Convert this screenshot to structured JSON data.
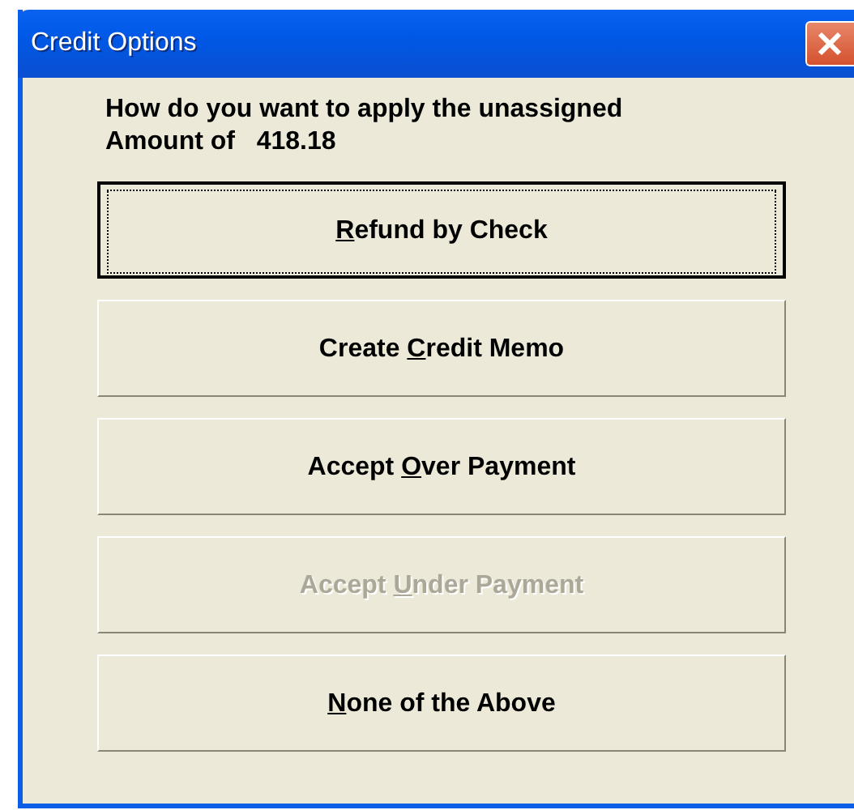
{
  "window": {
    "title": "Credit Options"
  },
  "message": [
    "How do you want to apply the unassigned",
    "Amount of   418.18"
  ],
  "buttons": [
    {
      "parts": [
        {
          "text": "R",
          "underlined": true
        },
        {
          "text": "efund by Check",
          "underlined": false
        }
      ],
      "focused": true,
      "disabled": false
    },
    {
      "parts": [
        {
          "text": "Create ",
          "underlined": false
        },
        {
          "text": "C",
          "underlined": true
        },
        {
          "text": "redit Memo",
          "underlined": false
        }
      ],
      "focused": false,
      "disabled": false
    },
    {
      "parts": [
        {
          "text": "Accept ",
          "underlined": false
        },
        {
          "text": "O",
          "underlined": true
        },
        {
          "text": "ver Payment",
          "underlined": false
        }
      ],
      "focused": false,
      "disabled": false
    },
    {
      "parts": [
        {
          "text": "Accept ",
          "underlined": false
        },
        {
          "text": "U",
          "underlined": true
        },
        {
          "text": "nder Payment",
          "underlined": false
        }
      ],
      "focused": false,
      "disabled": true
    },
    {
      "parts": [
        {
          "text": "N",
          "underlined": true
        },
        {
          "text": "one of the Above",
          "underlined": false
        }
      ],
      "focused": false,
      "disabled": false
    }
  ]
}
